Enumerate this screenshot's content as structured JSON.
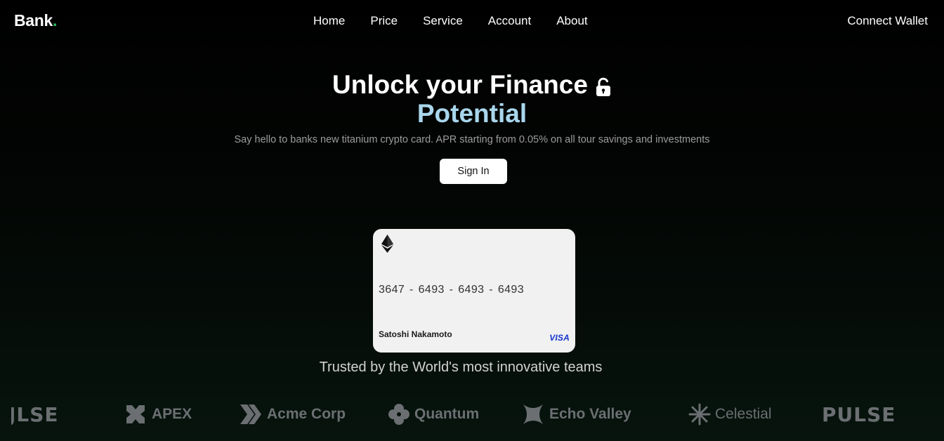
{
  "nav": {
    "brand": "Bank",
    "brand_dot": ".",
    "items": [
      {
        "label": "Home"
      },
      {
        "label": "Price"
      },
      {
        "label": "Service"
      },
      {
        "label": "Account"
      },
      {
        "label": "About"
      }
    ],
    "connect_wallet": "Connect Wallet"
  },
  "hero": {
    "title_line1": "Unlock your Finance",
    "title_line2": "Potential",
    "subtitle": "Say hello to banks new titanium crypto card. APR starting from 0.05% on all tour savings and investments",
    "signin_label": "Sign In"
  },
  "card": {
    "number": "3647 -  6493 -  6493 -  6493",
    "holder": "Satoshi Nakamoto",
    "network": "VISA",
    "icon": "ethereum-icon"
  },
  "trusted": {
    "heading": "Trusted by the World's most innovative teams",
    "logos": [
      {
        "name": "JLSE",
        "icon": ""
      },
      {
        "name": "APEX",
        "icon": "apex-icon"
      },
      {
        "name": "Acme Corp",
        "icon": "acme-chevron-icon"
      },
      {
        "name": "Quantum",
        "icon": "quantum-flower-icon"
      },
      {
        "name": "Echo Valley",
        "icon": "echo-x-icon"
      },
      {
        "name": "Celestial",
        "icon": "celestial-star-icon"
      },
      {
        "name": "PULSE",
        "icon": ""
      }
    ]
  },
  "colors": {
    "accent_green": "#22c55e",
    "potential_blue": "#a9d6ec",
    "card_bg": "#f1f1f1",
    "visa_blue": "#1434cb",
    "logo_gray": "#6b6f72"
  }
}
